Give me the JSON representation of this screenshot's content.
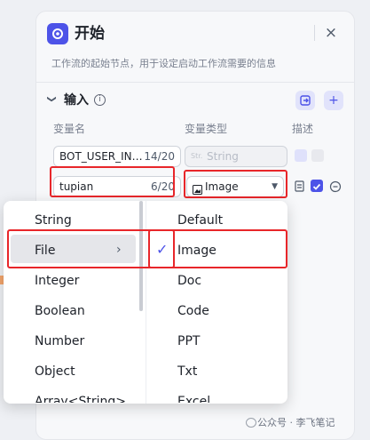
{
  "panel": {
    "title": "开始",
    "description": "工作流的起始节点，用于设定启动工作流需要的信息",
    "close_icon": "×"
  },
  "section": {
    "label": "输入",
    "info_icon": "i"
  },
  "columns": {
    "name": "变量名",
    "type": "变量类型",
    "desc": "描述"
  },
  "rows": [
    {
      "name": "BOT_USER_IN…",
      "count": "14/20",
      "type": "String"
    },
    {
      "name": "tupian",
      "count": "6/20",
      "type": "Image"
    }
  ],
  "type_menu": {
    "left_items": [
      "String",
      "File",
      "Integer",
      "Boolean",
      "Number",
      "Object",
      "Array<String>"
    ],
    "selected_left": "File",
    "right_items": [
      "Default",
      "Image",
      "Doc",
      "Code",
      "PPT",
      "Txt",
      "Excel"
    ],
    "selected_right": "Image"
  },
  "watermark": "公众号 · 李飞笔记",
  "colors": {
    "accent": "#4d53e8",
    "highlight": "#e8262a"
  }
}
